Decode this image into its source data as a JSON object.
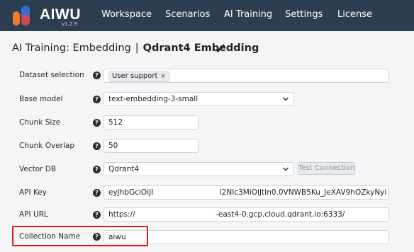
{
  "header": {
    "brand": "AIWU",
    "version": "v1.2.9",
    "nav": [
      "Workspace",
      "Scenarios",
      "AI Training",
      "Settings",
      "License"
    ]
  },
  "title": {
    "section": "AI Training: Embedding",
    "separator": "|",
    "name": "Qdrant4 Embedding"
  },
  "form": {
    "dataset_label": "Dataset selection",
    "dataset_tag": "User support",
    "dataset_tag_remove": "×",
    "base_model_label": "Base model",
    "base_model_value": "text-embedding-3-small",
    "chunk_size_label": "Chunk Size",
    "chunk_size_value": "512",
    "chunk_overlap_label": "Chunk Overlap",
    "chunk_overlap_value": "50",
    "vector_db_label": "Vector DB",
    "vector_db_value": "Qdrant4",
    "test_connection": "Test Connection",
    "api_key_label": "API Key",
    "api_key_start": "eyJhbGciOiJI",
    "api_key_end": "l2NIc3MiOiJtIn0.0VNWB5Ku_JeXAV9hOZkyNyi",
    "api_url_label": "API URL",
    "api_url_start": "https://",
    "api_url_end": "-east4-0.gcp.cloud.qdrant.io:6333/",
    "collection_label": "Collection Name",
    "collection_value": "aiwu",
    "help_glyph": "?"
  },
  "colors": {
    "header_bg": "#2d3e50",
    "highlight": "#e0181e",
    "logo_orange": "#f4792a",
    "logo_blue": "#2f6fd6"
  }
}
